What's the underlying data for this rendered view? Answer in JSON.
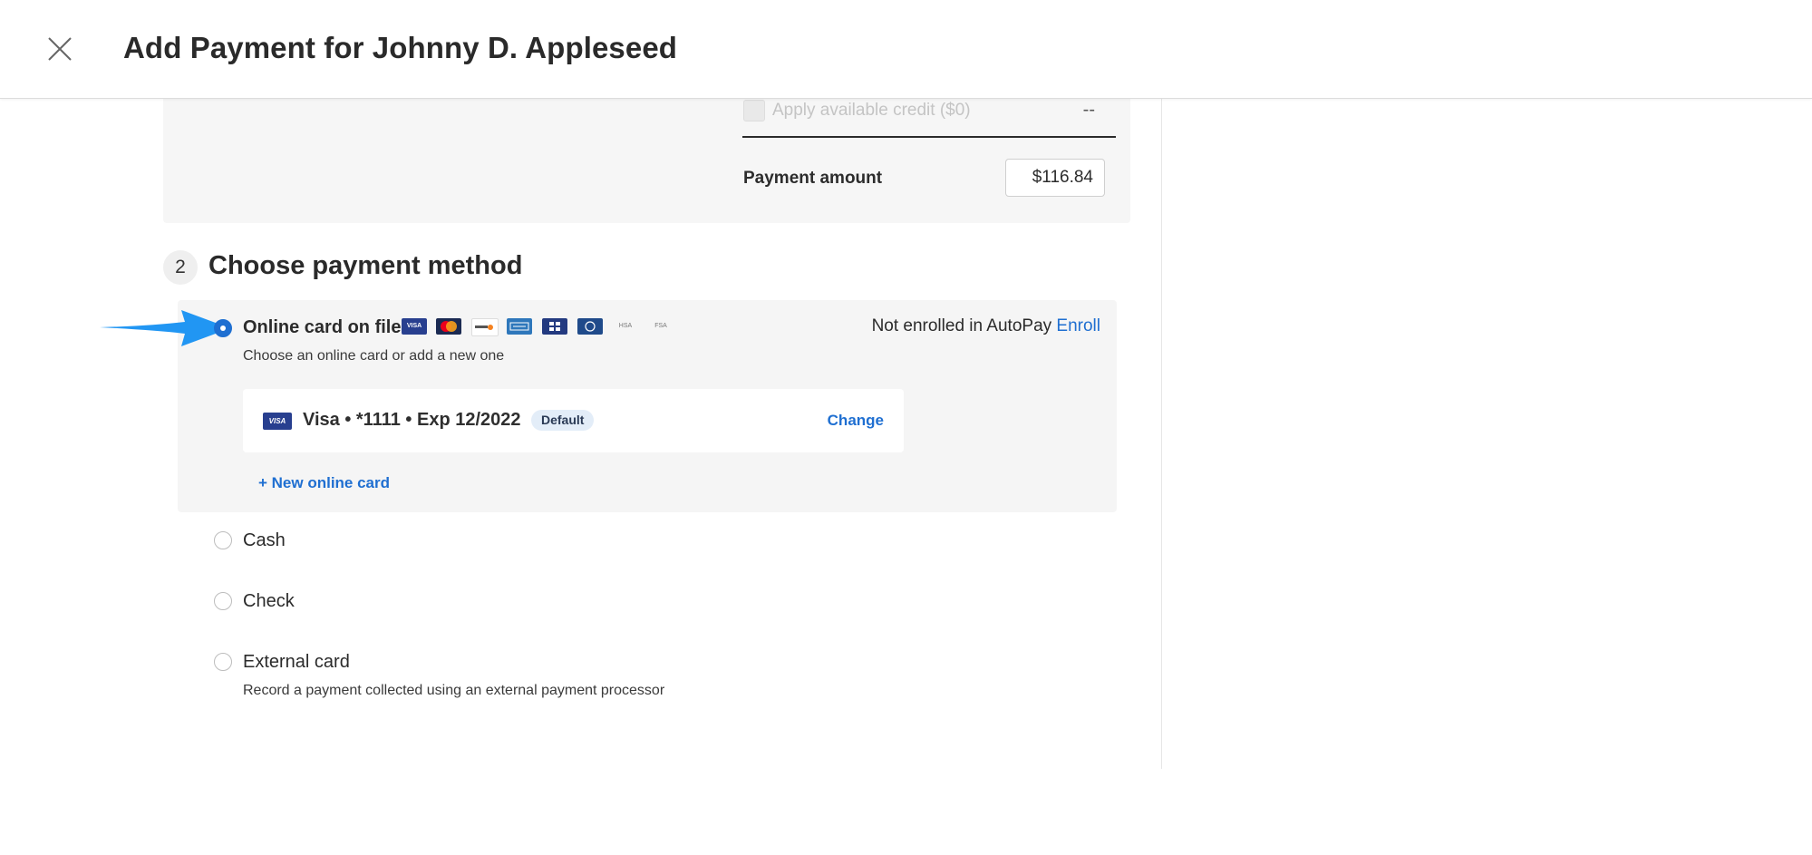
{
  "header": {
    "title": "Add Payment for Johnny D. Appleseed",
    "close_icon": "close-icon"
  },
  "summary": {
    "credit_label": "Apply available credit ($0)",
    "credit_value": "--",
    "payment_amount_label": "Payment amount",
    "payment_amount_value": "$116.84"
  },
  "section": {
    "step_number": "2",
    "title": "Choose payment method"
  },
  "options": {
    "online": {
      "label": "Online card on file",
      "subtitle": "Choose an online card or add a new one",
      "selected": true,
      "card_logos": [
        "VISA",
        "Mastercard",
        "DISCOVER",
        "AMERICAN EXPRESS",
        "JCB",
        "Diners Club",
        "HSA",
        "FSA"
      ],
      "autopay_text": "Not enrolled in AutoPay",
      "enroll_label": "Enroll",
      "card": {
        "brand_logo": "VISA",
        "description": "Visa • *1111 • Exp 12/2022",
        "badge": "Default",
        "change_label": "Change"
      },
      "new_card_label": "+ New online card"
    },
    "cash": {
      "label": "Cash",
      "selected": false
    },
    "check": {
      "label": "Check",
      "selected": false
    },
    "external": {
      "label": "External card",
      "subtitle": "Record a payment collected using an external payment processor",
      "selected": false
    }
  },
  "colors": {
    "accent": "#1f6fd1",
    "arrow": "#2196f3",
    "panel_bg": "#f5f5f5"
  }
}
